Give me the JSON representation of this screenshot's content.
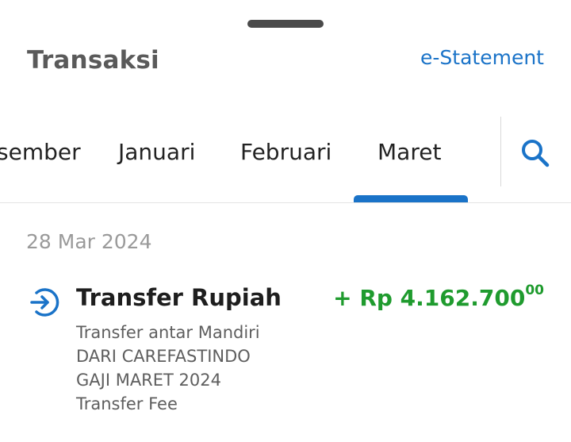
{
  "header": {
    "title": "Transaksi",
    "estatement_link": "e-Statement"
  },
  "month_tabs": {
    "items": [
      {
        "label": "sember",
        "selected": false
      },
      {
        "label": "Januari",
        "selected": false
      },
      {
        "label": "Februari",
        "selected": false
      },
      {
        "label": "Maret",
        "selected": true
      }
    ],
    "search_icon": "search-icon"
  },
  "transactions": {
    "date": "28 Mar 2024",
    "items": [
      {
        "icon": "transfer-in-icon",
        "title": "Transfer Rupiah",
        "amount_main": "+ Rp 4.162.700",
        "amount_cents": "00",
        "details": [
          "Transfer antar Mandiri",
          "DARI CAREFASTINDO",
          "GAJI MARET 2024",
          "Transfer Fee"
        ]
      }
    ]
  },
  "colors": {
    "accent": "#1a73c8",
    "credit_amount": "#1f9b2e",
    "title_text": "#5a5a5a",
    "date_text": "#9a9a9a"
  }
}
